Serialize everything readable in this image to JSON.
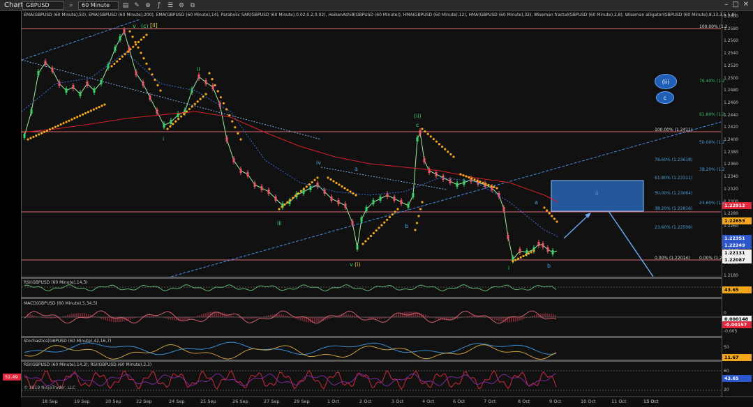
{
  "toolbar": {
    "title": "Chart",
    "instrument": "GBPUSD",
    "timeframe": "60 Minute"
  },
  "indicators_text": "EMA(GBPUSD (60 Minute),50), EMA(GBPUSD (60 Minute),200), EMA(GBPUSD (60 Minute),14), Parabolic SAR(GBPUSD (60 Minute),0.02,0.2,0.02), HeikenAshi8(GBPUSD (60 Minute)), HMA(GBPUSD (60 Minute),12), HMA(GBPUSD (60 Minute),32), Wiseman fractal(GBPUSD (60 Minute),2,8), Wiseman alligator(GBPUSD (60 Minute),8,13,3,5,5,8)",
  "panes": {
    "rsi1": "RSI(GBPUSD (60 Minute),14,3)",
    "macd": "MACD(GBPUSD (60 Minute),5,34,5)",
    "stoch": "Stochastics(GBPUSD (60 Minute),42,16,7)",
    "rsi2": "RSI(GBPUSD (60 Minute),14,3); RSI(GBPUSD (60 Minute),3,3)"
  },
  "copyright": "© 2019 NinjaTrader, LLC",
  "price_axis": [
    "1.2600",
    "1.2580",
    "1.2560",
    "1.2540",
    "1.2520",
    "1.2500",
    "1.2480",
    "1.2460",
    "1.2440",
    "1.2420",
    "1.2400",
    "1.2380",
    "1.2360",
    "1.2340",
    "1.2320",
    "1.2300",
    "1.2280",
    "1.2260",
    "1.2240",
    "1.2220",
    "1.2200",
    "1.2180"
  ],
  "price_tags": [
    {
      "label": "1.22912",
      "color": "#e0283c",
      "text": "#ffffff"
    },
    {
      "label": "1.22653",
      "color": "#f2a61d",
      "text": "#000000"
    },
    {
      "label": "1.22351",
      "color": "#2c56c9",
      "text": "#ffffff"
    },
    {
      "label": "1.22249",
      "color": "#2c56c9",
      "text": "#ffffff"
    },
    {
      "label": "1.22131",
      "color": "#f0f0f0",
      "text": "#000000"
    },
    {
      "label": "1.22087",
      "color": "#f0f0f0",
      "text": "#000000"
    }
  ],
  "rsi_tag": "43.65",
  "macd_tags": [
    "0.000148",
    "-0.00157"
  ],
  "macd_axis": [
    "0",
    "-0.005"
  ],
  "stoch_axis": [
    "50",
    "11.67"
  ],
  "rsi2_axis": [
    "60",
    "43.65",
    "20"
  ],
  "left_tag": "52.49",
  "dates": [
    "18 Sep",
    "19 Sep",
    "20 Sep",
    "22 Sep",
    "24 Sep",
    "25 Sep",
    "26 Sep",
    "27 Sep",
    "29 Sep",
    "1 Oct",
    "2 Oct",
    "3 Oct",
    "4 Oct",
    "6 Oct",
    "7 Oct",
    "8 Oct",
    "9 Oct",
    "10 Oct",
    "11 Oct",
    "13 Oct",
    "15 Oct"
  ],
  "fib_levels_a": [
    "100.00% (1.2411)",
    "78.60% (1.23618)",
    "61.80% (1.23311)",
    "50.00% (1.23064)",
    "38.20% (1.22816)",
    "23.60% (1.22509)",
    "0.00% (1.22014)"
  ],
  "fib_levels_b": [
    "100.00% (1.2",
    "76.40% (1.2",
    "61.80% (1.2",
    "50.00% (1.2",
    "38.20% (1.2",
    "23.60% (1.2",
    "0.00% (1.22"
  ],
  "wave_labels": {
    "v_top": "v",
    "c_top": "(c)",
    "ii_top": "[ii]",
    "i_1": "i",
    "ii_2": "ii",
    "iii": "iii",
    "iv": "iv",
    "a": "a",
    "b": "b",
    "v_bottom": "v",
    "i_paren": "(i)",
    "ii_paren": "(ii)",
    "c_mid": "c",
    "i_end": "i",
    "ii_box": "ii",
    "a_small": "a",
    "b_small": "b",
    "circle_ii": "(ii)",
    "circle_c": "c"
  },
  "colors": {
    "bg": "#111111",
    "ema50": "#3a6fd8",
    "ema200": "#d8202a",
    "sar": "#f2a61d",
    "trend": "#4a8ce0",
    "hline": "#e06a73",
    "rsi": "#5fae6f",
    "macd": "#c0392b",
    "stoch": "#3b8fd6"
  }
}
